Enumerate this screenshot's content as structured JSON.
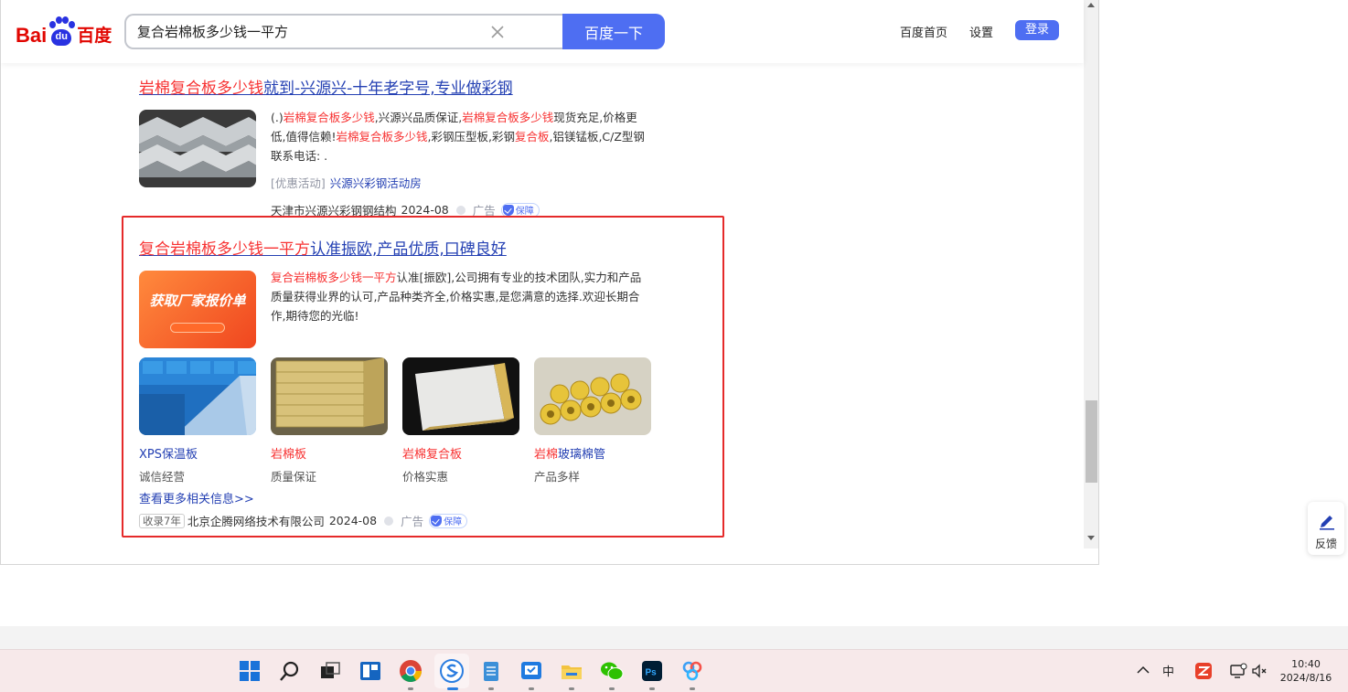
{
  "header": {
    "logo_bai": "Bai",
    "logo_du": "du",
    "logo_cn": "百度",
    "search_value": "复合岩棉板多少钱一平方",
    "search_button": "百度一下",
    "nav": {
      "home": "百度首页",
      "settings": "设置",
      "login": "登录"
    }
  },
  "result1": {
    "title_hl": "岩棉复合板多少钱",
    "title_rest": "就到-兴源兴-十年老字号,专业做彩钢",
    "desc": [
      {
        "t": "(.)",
        "h": false
      },
      {
        "t": "岩棉复合板多少钱",
        "h": true
      },
      {
        "t": ",兴源兴品质保证,",
        "h": false
      },
      {
        "t": "岩棉复合板多少钱",
        "h": true
      },
      {
        "t": "现货充足,价格更低,值得信赖!",
        "h": false
      },
      {
        "t": "岩棉复合板多少钱",
        "h": true
      },
      {
        "t": ",彩钢压型板,彩钢",
        "h": false
      },
      {
        "t": "复合板",
        "h": true
      },
      {
        "t": ",铝镁锰板,C/Z型钢联系电话: .",
        "h": false
      }
    ],
    "promo_label": "[优惠活动]",
    "promo_link": "兴源兴彩钢活动房",
    "company": "天津市兴源兴彩钢钢结构",
    "date": "2024-08",
    "ad": "广告",
    "bao": "保障"
  },
  "result2": {
    "title_hl": "复合岩棉板多少钱一平方",
    "title_rest": "认准振欧,产品优质,口碑良好",
    "banner_top": "",
    "banner_main": "获取厂家报价单",
    "banner_sub": "",
    "banner_btn": "",
    "desc": [
      {
        "t": "复合岩棉板多少钱一平方",
        "h": true
      },
      {
        "t": "认准[振欧],公司拥有专业的技术团队,实力和产品质量获得业界的认可,产品种类齐全,价格实惠,是您满意的选择.欢迎长期合作,期待您的光临!",
        "h": false
      }
    ],
    "products": [
      {
        "name_hl": "",
        "name": "XPS保温板",
        "sub": "诚信经营"
      },
      {
        "name_hl": "岩棉板",
        "name": "",
        "sub": "质量保证"
      },
      {
        "name_hl": "岩棉复合板",
        "name": "",
        "sub": "价格实惠"
      },
      {
        "name_hl": "岩棉",
        "name": "玻璃棉管",
        "sub": "产品多样"
      }
    ],
    "more": "查看更多相关信息>>",
    "shoulu": "收录7年",
    "company": "北京企腾网络技术有限公司",
    "date": "2024-08",
    "ad": "广告",
    "bao": "保障"
  },
  "feedback": "反馈",
  "taskbar": {
    "tray_ime": "中",
    "clock_time": "10:40",
    "clock_date": "2024/8/16"
  },
  "colors": {
    "accent": "#4e6ef2",
    "highlight": "#f73131",
    "link": "#2440b3",
    "ad_frame": "#e52a2a"
  }
}
